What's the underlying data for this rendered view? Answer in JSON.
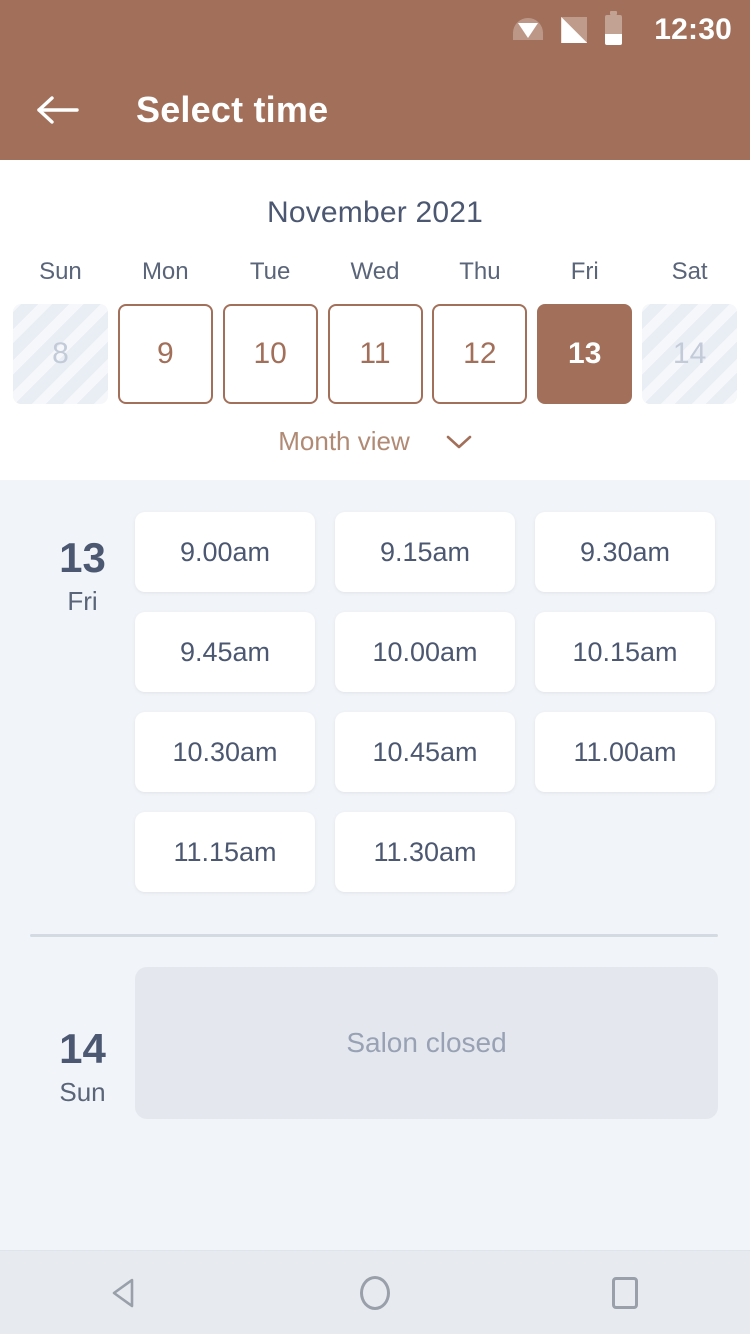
{
  "status_bar": {
    "clock": "12:30",
    "icons": [
      "wifi-icon",
      "cell-signal-icon",
      "battery-icon"
    ]
  },
  "app_bar": {
    "back_icon": "arrow-left-icon",
    "title": "Select time"
  },
  "calendar": {
    "month_label": "November 2021",
    "day_names": [
      "Sun",
      "Mon",
      "Tue",
      "Wed",
      "Thu",
      "Fri",
      "Sat"
    ],
    "days": [
      {
        "number": "8",
        "state": "disabled"
      },
      {
        "number": "9",
        "state": "enabled"
      },
      {
        "number": "10",
        "state": "enabled"
      },
      {
        "number": "11",
        "state": "enabled"
      },
      {
        "number": "12",
        "state": "enabled"
      },
      {
        "number": "13",
        "state": "selected"
      },
      {
        "number": "14",
        "state": "disabled"
      }
    ],
    "month_view_label": "Month view",
    "month_view_icon": "chevron-down-icon"
  },
  "schedule": [
    {
      "day_number": "13",
      "day_name": "Fri",
      "slots": [
        "9.00am",
        "9.15am",
        "9.30am",
        "9.45am",
        "10.00am",
        "10.15am",
        "10.30am",
        "10.45am",
        "11.00am",
        "11.15am",
        "11.30am"
      ]
    },
    {
      "day_number": "14",
      "day_name": "Sun",
      "closed_label": "Salon closed"
    }
  ],
  "nav_bar": {
    "back_icon": "triangle-back-icon",
    "home_icon": "circle-home-icon",
    "recents_icon": "square-recents-icon"
  },
  "colors": {
    "brand": "#a2705a",
    "page_background": "#f1f4f8",
    "text_primary": "#4c5871",
    "text_muted": "#98a2b4"
  }
}
